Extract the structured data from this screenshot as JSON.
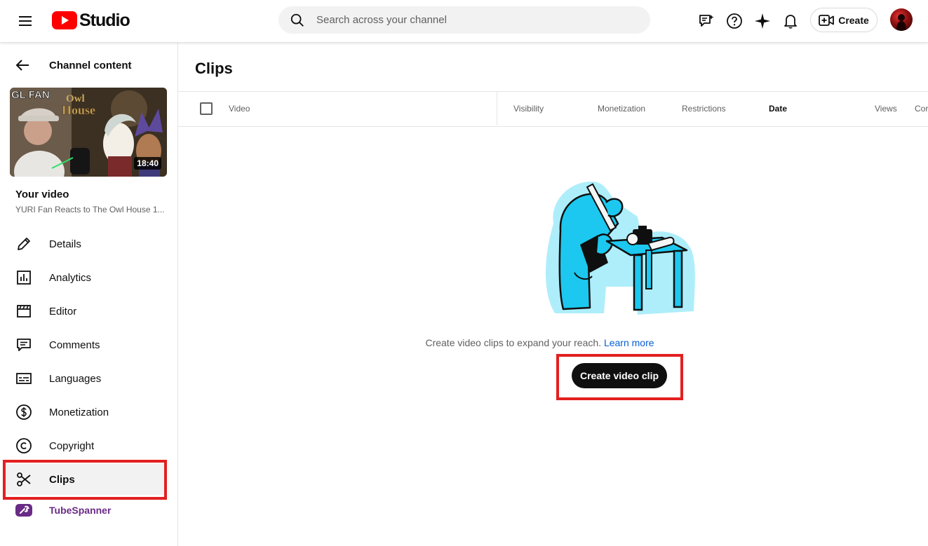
{
  "header": {
    "logo_text": "Studio",
    "search_placeholder": "Search across your channel",
    "create_label": "Create"
  },
  "sidebar": {
    "back_label": "Channel content",
    "thumbnail_duration": "18:40",
    "your_video_label": "Your video",
    "video_title": "YURI Fan Reacts to The Owl House 1...",
    "items": [
      {
        "label": "Details",
        "icon": "pencil-icon"
      },
      {
        "label": "Analytics",
        "icon": "analytics-icon"
      },
      {
        "label": "Editor",
        "icon": "clapperboard-icon"
      },
      {
        "label": "Comments",
        "icon": "comments-icon"
      },
      {
        "label": "Languages",
        "icon": "subtitles-icon"
      },
      {
        "label": "Monetization",
        "icon": "dollar-icon"
      },
      {
        "label": "Copyright",
        "icon": "copyright-icon"
      },
      {
        "label": "Clips",
        "icon": "scissors-icon",
        "active": true
      },
      {
        "label": "TubeSpanner",
        "icon": "tubespanner-icon"
      }
    ]
  },
  "main": {
    "title": "Clips",
    "columns": [
      "Video",
      "Visibility",
      "Monetization",
      "Restrictions",
      "Date",
      "Views",
      "Cor"
    ],
    "sorted_column": "Date",
    "empty_message": "Create video clips to expand your reach.",
    "learn_more": "Learn more",
    "cta_label": "Create video clip"
  },
  "colors": {
    "brand_red": "#ff0000",
    "highlight_red": "#e32020",
    "link_blue": "#065fd4",
    "illustration_cyan": "#1cc8ef",
    "extension_purple": "#6a2b86"
  }
}
